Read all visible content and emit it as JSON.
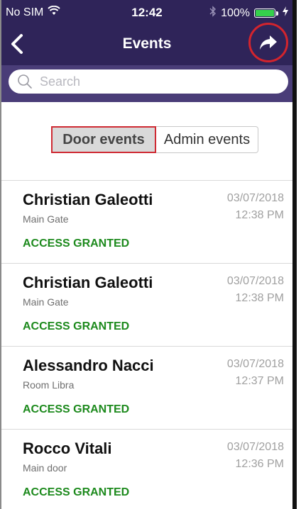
{
  "status_bar": {
    "carrier": "No SIM",
    "time": "12:42",
    "battery": "100%",
    "battery_level": 1.0
  },
  "nav": {
    "title": "Events",
    "back_icon": "chevron-left-icon",
    "share_icon": "share-arrow-icon"
  },
  "search": {
    "placeholder": "Search",
    "value": ""
  },
  "tabs": [
    {
      "label": "Door events",
      "selected": true
    },
    {
      "label": "Admin events",
      "selected": false
    }
  ],
  "events": [
    {
      "name": "Christian Galeotti",
      "place": "Main Gate",
      "status": "ACCESS GRANTED",
      "date": "03/07/2018",
      "time": "12:38 PM"
    },
    {
      "name": "Christian Galeotti",
      "place": "Main Gate",
      "status": "ACCESS GRANTED",
      "date": "03/07/2018",
      "time": "12:38 PM"
    },
    {
      "name": "Alessandro Nacci",
      "place": "Room Libra",
      "status": "ACCESS GRANTED",
      "date": "03/07/2018",
      "time": "12:37 PM"
    },
    {
      "name": "Rocco Vitali",
      "place": "Main door",
      "status": "ACCESS GRANTED",
      "date": "03/07/2018",
      "time": "12:36 PM"
    }
  ],
  "colors": {
    "header": "#2f2459",
    "search_bg": "#4a3d78",
    "granted": "#1d8a1d",
    "highlight": "#d3242d"
  }
}
